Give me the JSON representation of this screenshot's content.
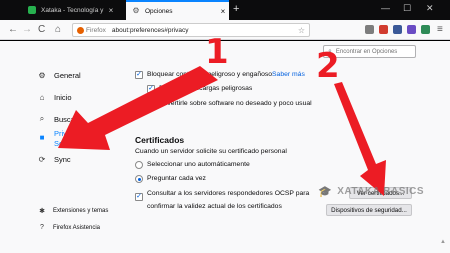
{
  "tabs": [
    {
      "title": "Xataka - Tecnología y gadgets",
      "close": "×"
    },
    {
      "title": "Opciones",
      "close": "×"
    }
  ],
  "new_tab": "+",
  "window_controls": {
    "minimize": "—",
    "maximize": "☐",
    "close": "✕"
  },
  "nav": {
    "back": "←",
    "forward": "→",
    "reload": "C",
    "home": "⌂",
    "brand": "Firefox",
    "url": "about:preferences#privacy",
    "bookmark": "☆"
  },
  "search": {
    "icon": "search-icon",
    "glyph": "⌕",
    "placeholder": "Encontrar en Opciones"
  },
  "sidebar": {
    "items": [
      {
        "label": "General",
        "icon": "⚙"
      },
      {
        "label": "Inicio",
        "icon": "⌂"
      },
      {
        "label": "Buscar",
        "icon": "⌕"
      },
      {
        "label": "Privacidad &",
        "label2": "Seguridad",
        "icon": "🔒"
      },
      {
        "label": "Sync",
        "icon": "⟳"
      }
    ],
    "footer": [
      {
        "label": "Extensiones y temas",
        "icon": "✱"
      },
      {
        "label": "Firefox Asistencia",
        "icon": "?"
      }
    ]
  },
  "security": {
    "block_dangerous": {
      "label": "Bloquear contenido peligroso y engañoso",
      "link": "Saber más",
      "checked": "✓"
    },
    "block_downloads": {
      "label": "Bloquear descargas peligrosas",
      "checked": "✓"
    },
    "warn_unwanted": {
      "label": "Advertirle sobre software no deseado y poco usual",
      "checked": "✓"
    }
  },
  "certificates": {
    "heading": "Certificados",
    "intro": "Cuando un servidor solicite su certificado personal",
    "options": [
      {
        "label": "Seleccionar uno automáticamente",
        "selected": false
      },
      {
        "label": "Preguntar cada vez",
        "selected": true
      }
    ],
    "ocsp_line1": "Consultar a los servidores respondedores OCSP para",
    "ocsp_line2": "confirmar la validez actual de los certificados",
    "ocsp_checked": "✓",
    "view_button": "Ver certificados...",
    "devices_button": "Dispositivos de seguridad..."
  },
  "annotations": {
    "first": "1",
    "second": "2",
    "color": "#ec1c24"
  },
  "watermark": {
    "icon": "graduation-cap-icon",
    "glyph": "🎓",
    "text": "XATAKA BASICS"
  },
  "colors": {
    "accent": "#0a84ff",
    "link": "#0060df",
    "arrow": "#ec1c24"
  }
}
